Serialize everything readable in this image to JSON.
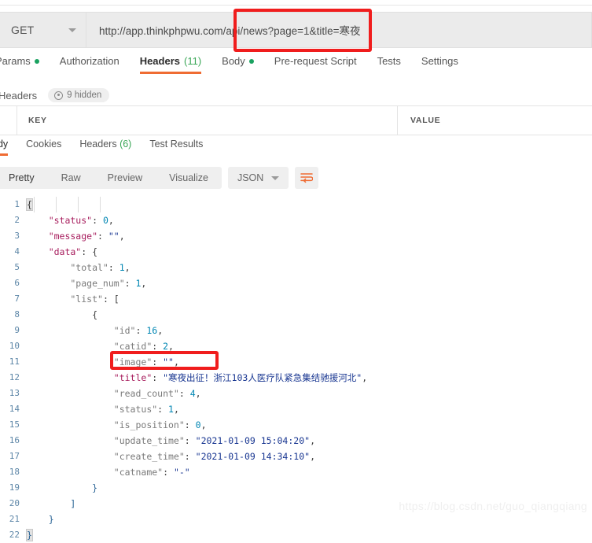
{
  "request": {
    "method": "GET",
    "url": "http://app.thinkphpwu.com/api/news?page=1&title=寒夜",
    "tabs": [
      {
        "label": "Params",
        "dot": true,
        "count": "",
        "active": false
      },
      {
        "label": "Authorization",
        "dot": false,
        "count": "",
        "active": false
      },
      {
        "label": "Headers",
        "dot": false,
        "count": "(11)",
        "active": true
      },
      {
        "label": "Body",
        "dot": true,
        "count": "",
        "active": false
      },
      {
        "label": "Pre-request Script",
        "dot": false,
        "count": "",
        "active": false
      },
      {
        "label": "Tests",
        "dot": false,
        "count": "",
        "active": false
      },
      {
        "label": "Settings",
        "dot": false,
        "count": "",
        "active": false
      }
    ],
    "headers_section": {
      "title": "Headers",
      "hidden_label": "9 hidden",
      "columns": {
        "key": "KEY",
        "value": "VALUE"
      }
    }
  },
  "response": {
    "tabs": [
      {
        "label": "ody",
        "count": "",
        "active": true
      },
      {
        "label": "Cookies",
        "count": "",
        "active": false
      },
      {
        "label": "Headers",
        "count": "(6)",
        "active": false
      },
      {
        "label": "Test Results",
        "count": "",
        "active": false
      }
    ],
    "viewer": {
      "modes": [
        {
          "label": "Pretty",
          "active": true
        },
        {
          "label": "Raw",
          "active": false
        },
        {
          "label": "Preview",
          "active": false
        },
        {
          "label": "Visualize",
          "active": false
        }
      ],
      "format": "JSON",
      "wrap_icon": "wrap-lines-icon"
    },
    "body_lines": [
      {
        "n": 1,
        "guides": 0,
        "tokens": [
          {
            "t": "{",
            "c": "p brace-hl"
          }
        ]
      },
      {
        "n": 2,
        "guides": 1,
        "tokens": [
          {
            "t": "    \"status\"",
            "c": "k"
          },
          {
            "t": ": ",
            "c": "p"
          },
          {
            "t": "0",
            "c": "n"
          },
          {
            "t": ",",
            "c": "p"
          }
        ]
      },
      {
        "n": 3,
        "guides": 1,
        "tokens": [
          {
            "t": "    \"message\"",
            "c": "k"
          },
          {
            "t": ": ",
            "c": "p"
          },
          {
            "t": "\"\"",
            "c": "s"
          },
          {
            "t": ",",
            "c": "p"
          }
        ]
      },
      {
        "n": 4,
        "guides": 1,
        "tokens": [
          {
            "t": "    \"data\"",
            "c": "k"
          },
          {
            "t": ": {",
            "c": "p"
          }
        ]
      },
      {
        "n": 5,
        "guides": 2,
        "tokens": [
          {
            "t": "        \"total\"",
            "c": "k2"
          },
          {
            "t": ": ",
            "c": "p"
          },
          {
            "t": "1",
            "c": "n"
          },
          {
            "t": ",",
            "c": "p"
          }
        ]
      },
      {
        "n": 6,
        "guides": 2,
        "tokens": [
          {
            "t": "        \"page_num\"",
            "c": "k2"
          },
          {
            "t": ": ",
            "c": "p"
          },
          {
            "t": "1",
            "c": "n"
          },
          {
            "t": ",",
            "c": "p"
          }
        ]
      },
      {
        "n": 7,
        "guides": 2,
        "tokens": [
          {
            "t": "        \"list\"",
            "c": "k2"
          },
          {
            "t": ": [",
            "c": "p"
          }
        ]
      },
      {
        "n": 8,
        "guides": 3,
        "tokens": [
          {
            "t": "            {",
            "c": "p"
          }
        ]
      },
      {
        "n": 9,
        "guides": 4,
        "tokens": [
          {
            "t": "                \"id\"",
            "c": "k2"
          },
          {
            "t": ": ",
            "c": "p"
          },
          {
            "t": "16",
            "c": "n"
          },
          {
            "t": ",",
            "c": "p"
          }
        ]
      },
      {
        "n": 10,
        "guides": 4,
        "tokens": [
          {
            "t": "                \"catid\"",
            "c": "k2"
          },
          {
            "t": ": ",
            "c": "p"
          },
          {
            "t": "2",
            "c": "n"
          },
          {
            "t": ",",
            "c": "p"
          }
        ]
      },
      {
        "n": 11,
        "guides": 4,
        "tokens": [
          {
            "t": "                \"image\"",
            "c": "k2"
          },
          {
            "t": ": ",
            "c": "p"
          },
          {
            "t": "\"\"",
            "c": "s"
          },
          {
            "t": ",",
            "c": "p"
          }
        ]
      },
      {
        "n": 12,
        "guides": 4,
        "tokens": [
          {
            "t": "                \"title\"",
            "c": "k"
          },
          {
            "t": ": ",
            "c": "p"
          },
          {
            "t": "\"寒夜出征！浙江103人医疗队紧急集结驰援河北\"",
            "c": "s"
          },
          {
            "t": ",",
            "c": "p"
          }
        ]
      },
      {
        "n": 13,
        "guides": 4,
        "tokens": [
          {
            "t": "                \"read_count\"",
            "c": "k2"
          },
          {
            "t": ": ",
            "c": "p"
          },
          {
            "t": "4",
            "c": "n"
          },
          {
            "t": ",",
            "c": "p"
          }
        ]
      },
      {
        "n": 14,
        "guides": 4,
        "tokens": [
          {
            "t": "                \"status\"",
            "c": "k2"
          },
          {
            "t": ": ",
            "c": "p"
          },
          {
            "t": "1",
            "c": "n"
          },
          {
            "t": ",",
            "c": "p"
          }
        ]
      },
      {
        "n": 15,
        "guides": 4,
        "tokens": [
          {
            "t": "                \"is_position\"",
            "c": "k2"
          },
          {
            "t": ": ",
            "c": "p"
          },
          {
            "t": "0",
            "c": "n"
          },
          {
            "t": ",",
            "c": "p"
          }
        ]
      },
      {
        "n": 16,
        "guides": 4,
        "tokens": [
          {
            "t": "                \"update_time\"",
            "c": "k2"
          },
          {
            "t": ": ",
            "c": "p"
          },
          {
            "t": "\"2021-01-09 15:04:20\"",
            "c": "s"
          },
          {
            "t": ",",
            "c": "p"
          }
        ]
      },
      {
        "n": 17,
        "guides": 4,
        "tokens": [
          {
            "t": "                \"create_time\"",
            "c": "k2"
          },
          {
            "t": ": ",
            "c": "p"
          },
          {
            "t": "\"2021-01-09 14:34:10\"",
            "c": "s"
          },
          {
            "t": ",",
            "c": "p"
          }
        ]
      },
      {
        "n": 18,
        "guides": 4,
        "tokens": [
          {
            "t": "                \"catname\"",
            "c": "k2"
          },
          {
            "t": ": ",
            "c": "p"
          },
          {
            "t": "\"-\"",
            "c": "s"
          }
        ]
      },
      {
        "n": 19,
        "guides": 3,
        "tokens": [
          {
            "t": "            }",
            "c": "b"
          }
        ]
      },
      {
        "n": 20,
        "guides": 2,
        "tokens": [
          {
            "t": "        ]",
            "c": "b"
          }
        ]
      },
      {
        "n": 21,
        "guides": 1,
        "tokens": [
          {
            "t": "    }",
            "c": "b"
          }
        ]
      },
      {
        "n": 22,
        "guides": 0,
        "tokens": [
          {
            "t": "}",
            "c": "b brace-hl"
          }
        ]
      }
    ]
  },
  "annotations": {
    "color": "#f01d1d",
    "url_query_highlight": "news?page=1&title=寒夜",
    "title_key_highlight": "\"title\": \"寒夜出征！"
  },
  "watermark": "https://blog.csdn.net/guo_qiangqiang"
}
